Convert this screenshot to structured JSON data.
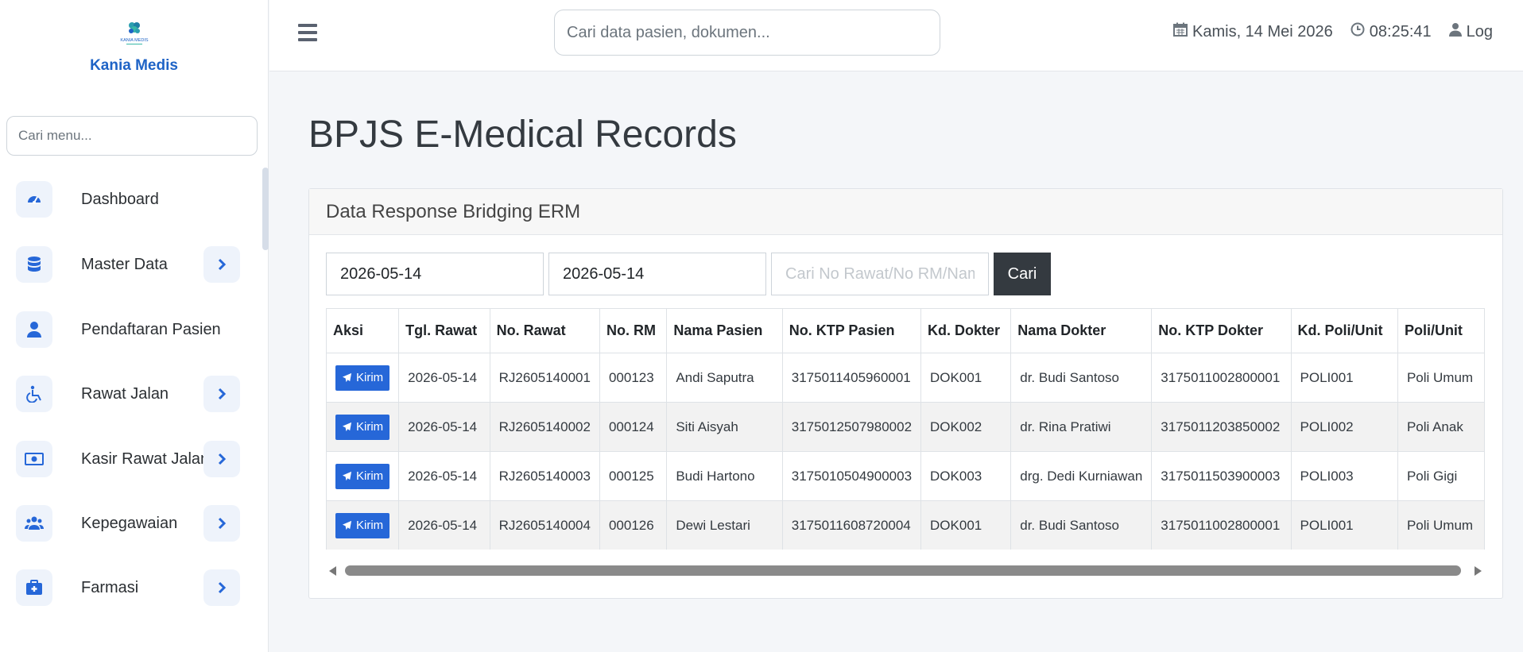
{
  "brand": {
    "name": "Kania Medis",
    "logo_text": "KANIA MEDIS"
  },
  "sidebar": {
    "search_placeholder": "Cari menu...",
    "items": [
      {
        "label": "Dashboard",
        "icon": "gauge-icon",
        "has_submenu": false
      },
      {
        "label": "Master Data",
        "icon": "database-icon",
        "has_submenu": true
      },
      {
        "label": "Pendaftaran Pasien",
        "icon": "user-icon",
        "has_submenu": false
      },
      {
        "label": "Rawat Jalan",
        "icon": "wheelchair-icon",
        "has_submenu": true
      },
      {
        "label": "Kasir Rawat Jalan",
        "icon": "money-icon",
        "has_submenu": true
      },
      {
        "label": "Kepegawaian",
        "icon": "users-icon",
        "has_submenu": true
      },
      {
        "label": "Farmasi",
        "icon": "medkit-icon",
        "has_submenu": true
      }
    ]
  },
  "header": {
    "search_placeholder": "Cari data pasien, dokumen...",
    "date": "Kamis, 14 Mei 2026",
    "time": "08:25:41",
    "user_label": "Log"
  },
  "page": {
    "title": "BPJS E-Medical Records",
    "card_title": "Data Response Bridging ERM"
  },
  "filters": {
    "date_from": "2026-05-14",
    "date_to": "2026-05-14",
    "keyword_placeholder": "Cari No Rawat/No RM/Nama",
    "search_button": "Cari"
  },
  "table": {
    "columns": [
      "Aksi",
      "Tgl. Rawat",
      "No. Rawat",
      "No. RM",
      "Nama Pasien",
      "No. KTP Pasien",
      "Kd. Dokter",
      "Nama Dokter",
      "No. KTP Dokter",
      "Kd. Poli/Unit",
      "Poli/Unit"
    ],
    "action_label": "Kirim",
    "rows": [
      [
        "2026-05-14",
        "RJ2605140001",
        "000123",
        "Andi Saputra",
        "3175011405960001",
        "DOK001",
        "dr. Budi Santoso",
        "3175011002800001",
        "POLI001",
        "Poli Umum"
      ],
      [
        "2026-05-14",
        "RJ2605140002",
        "000124",
        "Siti Aisyah",
        "3175012507980002",
        "DOK002",
        "dr. Rina Pratiwi",
        "3175011203850002",
        "POLI002",
        "Poli Anak"
      ],
      [
        "2026-05-14",
        "RJ2605140003",
        "000125",
        "Budi Hartono",
        "3175010504900003",
        "DOK003",
        "drg. Dedi Kurniawan",
        "3175011503900003",
        "POLI003",
        "Poli Gigi"
      ],
      [
        "2026-05-14",
        "RJ2605140004",
        "000126",
        "Dewi Lestari",
        "3175011608720004",
        "DOK001",
        "dr. Budi Santoso",
        "3175011002800001",
        "POLI001",
        "Poli Umum"
      ]
    ]
  },
  "colors": {
    "accent": "#1e63c6",
    "button_dark": "#343a40",
    "button_primary": "#2667d8"
  }
}
